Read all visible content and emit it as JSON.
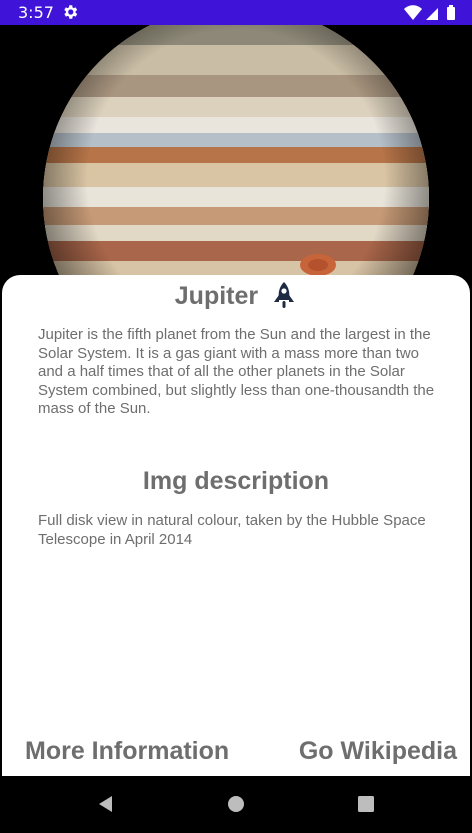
{
  "status_bar": {
    "time": "3:57",
    "background": "#3f14d8",
    "icons": [
      "gear-icon",
      "wifi-icon",
      "signal-icon",
      "battery-icon"
    ]
  },
  "planet": {
    "name": "Jupiter",
    "title_icon": "rocket-icon",
    "description": "Jupiter is the fifth planet from the Sun and the largest in the Solar System. It is a gas giant with a mass more than two and a half times that of all the other planets in the Solar System combined, but slightly less than one-thousandth the mass of the Sun."
  },
  "image_section": {
    "heading": "Img description",
    "text": "Full disk view in natural colour, taken by the Hubble Space Telescope in April 2014"
  },
  "actions": {
    "more_info_label": "More Information",
    "wikipedia_label": "Go Wikipedia"
  },
  "navigation": {
    "icons": [
      "back-icon",
      "home-icon",
      "recents-icon"
    ]
  },
  "colors": {
    "text": "#6e6e6e",
    "card": "#ffffff",
    "rocket": "#1f2a44"
  }
}
